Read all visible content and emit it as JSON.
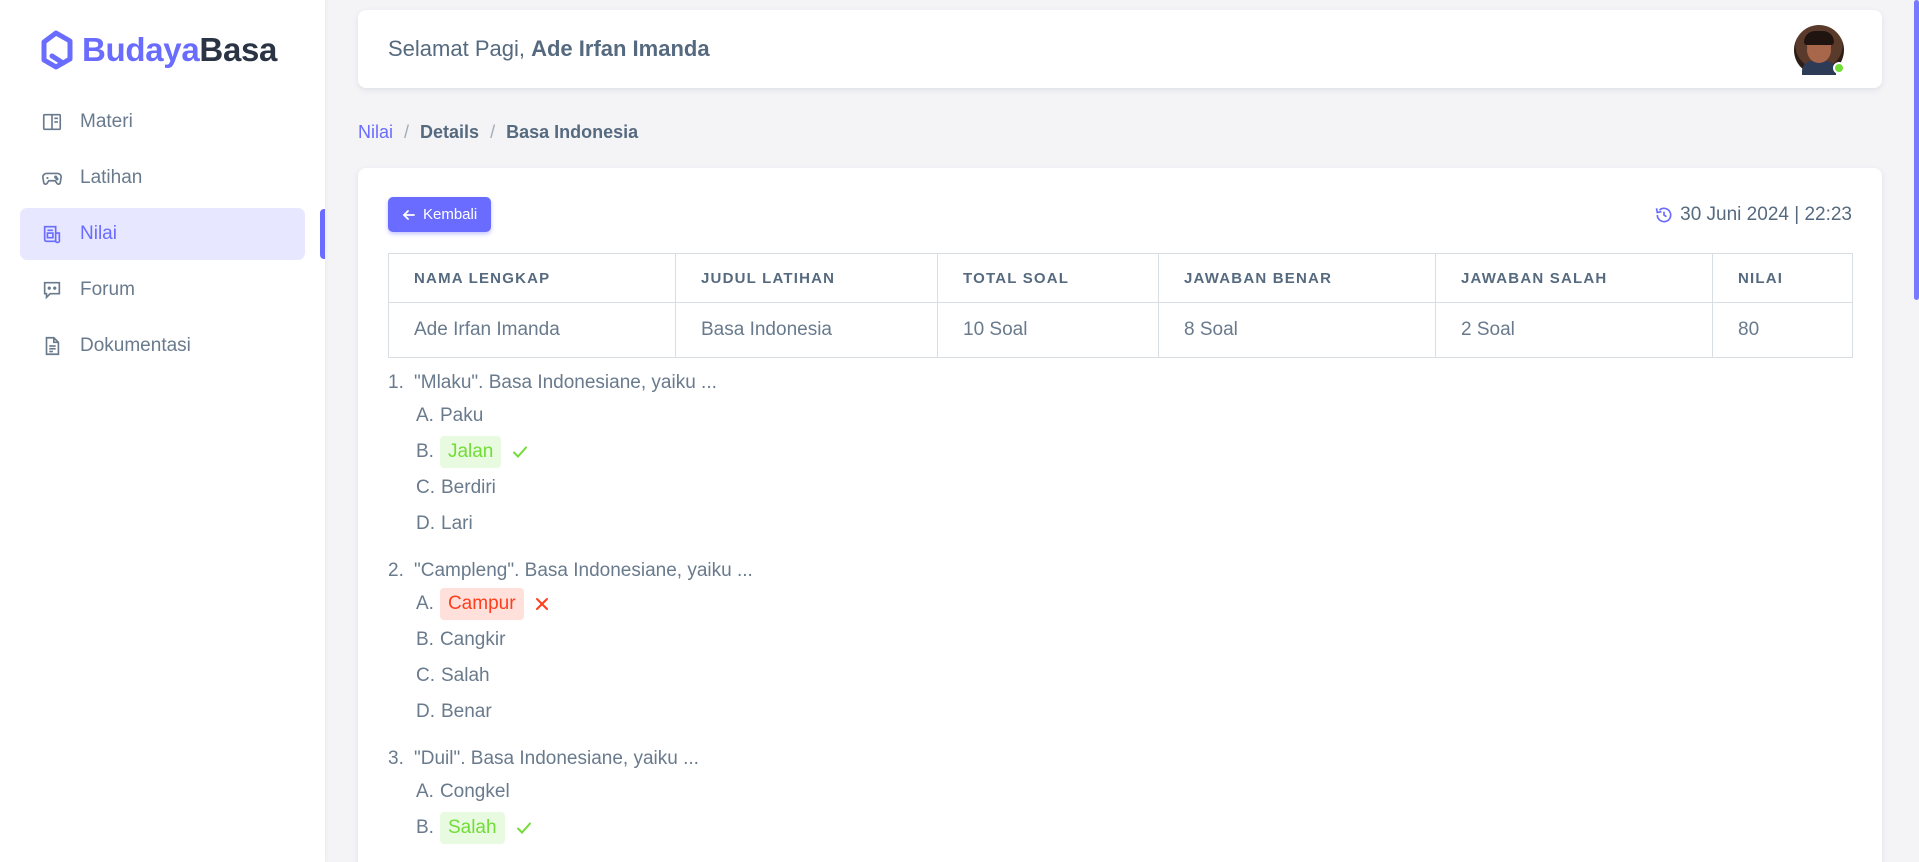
{
  "brand": {
    "part1": "Budaya",
    "part2": "Basa",
    "accent": "#696cff"
  },
  "sidebar": {
    "items": [
      {
        "label": "Materi",
        "icon": "book-open-icon",
        "active": false
      },
      {
        "label": "Latihan",
        "icon": "gamepad-icon",
        "active": false
      },
      {
        "label": "Nilai",
        "icon": "report-icon",
        "active": true
      },
      {
        "label": "Forum",
        "icon": "chat-icon",
        "active": false
      },
      {
        "label": "Dokumentasi",
        "icon": "document-icon",
        "active": false
      }
    ]
  },
  "header": {
    "greeting": "Selamat Pagi,",
    "user_name": "Ade Irfan Imanda",
    "avatar_icon": "user-avatar",
    "status": "online"
  },
  "breadcrumb": {
    "items": [
      "Nilai",
      "Details",
      "Basa Indonesia"
    ]
  },
  "card": {
    "back_label": "Kembali",
    "datetime": "30 Juni 2024 | 22:23",
    "table": {
      "headers": [
        "Nama Lengkap",
        "Judul Latihan",
        "Total Soal",
        "Jawaban Benar",
        "Jawaban Salah",
        "Nilai"
      ],
      "row": [
        "Ade Irfan Imanda",
        "Basa Indonesia",
        "10 Soal",
        "8 Soal",
        "2 Soal",
        "80"
      ]
    }
  },
  "questions": [
    {
      "number": "1.",
      "text": "\"Mlaku\". Basa Indonesiane, yaiku ...",
      "options": [
        {
          "letter": "A.",
          "text": "Paku",
          "state": "none"
        },
        {
          "letter": "B.",
          "text": "Jalan",
          "state": "correct"
        },
        {
          "letter": "C.",
          "text": "Berdiri",
          "state": "none"
        },
        {
          "letter": "D.",
          "text": "Lari",
          "state": "none"
        }
      ]
    },
    {
      "number": "2.",
      "text": "\"Campleng\". Basa Indonesiane, yaiku ...",
      "options": [
        {
          "letter": "A.",
          "text": "Campur",
          "state": "wrong"
        },
        {
          "letter": "B.",
          "text": "Cangkir",
          "state": "none"
        },
        {
          "letter": "C.",
          "text": "Salah",
          "state": "none"
        },
        {
          "letter": "D.",
          "text": "Benar",
          "state": "none"
        }
      ]
    },
    {
      "number": "3.",
      "text": "\"Duil\". Basa Indonesiane, yaiku ...",
      "options": [
        {
          "letter": "A.",
          "text": "Congkel",
          "state": "none"
        },
        {
          "letter": "B.",
          "text": "Salah",
          "state": "correct"
        }
      ]
    }
  ],
  "colors": {
    "correct": "#71dd37",
    "wrong": "#ff3e1d",
    "text": "#697a8d"
  }
}
